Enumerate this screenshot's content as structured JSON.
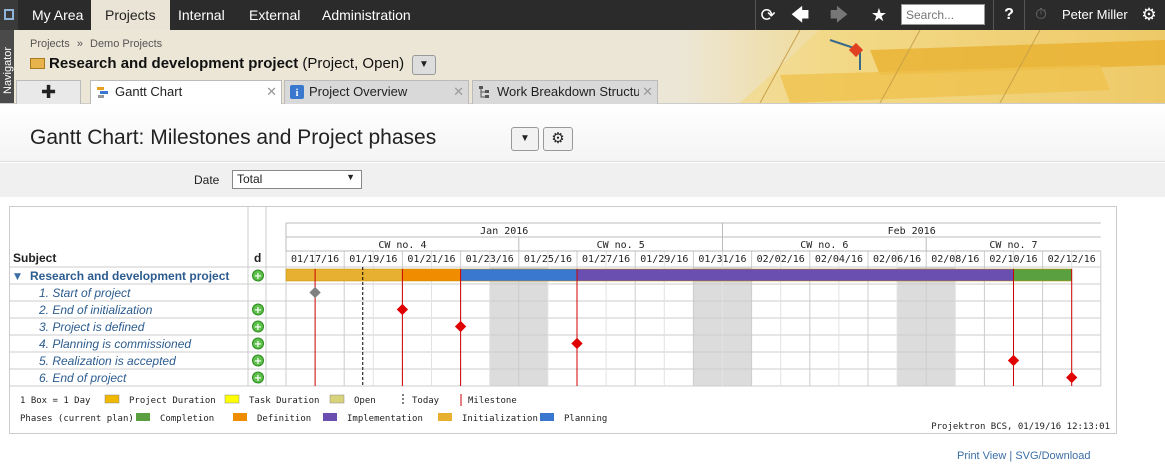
{
  "topnav": {
    "tabs": [
      "My Area",
      "Projects",
      "Internal",
      "External",
      "Administration"
    ],
    "active": "Projects",
    "search_placeholder": "Search...",
    "user": "Peter Miller"
  },
  "navigator_label": "Navigator",
  "breadcrumb": {
    "parent": "Projects",
    "separator": "»",
    "current": "Demo Projects"
  },
  "project": {
    "name": "Research and development project",
    "status": "(Project, Open)"
  },
  "tabs": [
    {
      "label": "Gantt Chart",
      "active": true
    },
    {
      "label": "Project Overview",
      "active": false
    },
    {
      "label": "Work Breakdown Structur",
      "active": false
    }
  ],
  "page_title": "Gantt Chart: Milestones and Project phases",
  "filter": {
    "label": "Date",
    "value": "Total"
  },
  "gantt": {
    "subject_header": "Subject",
    "d_header": "d",
    "months": [
      {
        "label": "Jan 2016",
        "start": 0,
        "end": 15
      },
      {
        "label": "Feb 2016",
        "start": 15,
        "end": 28
      }
    ],
    "weeks": [
      {
        "label": "CW no. 4",
        "start": 0,
        "end": 8
      },
      {
        "label": "CW no. 5",
        "start": 8,
        "end": 15
      },
      {
        "label": "CW no. 6",
        "start": 15,
        "end": 22
      },
      {
        "label": "CW no. 7",
        "start": 22,
        "end": 28
      }
    ],
    "date_labels": [
      "01/17/16",
      "01/19/16",
      "01/21/16",
      "01/23/16",
      "01/25/16",
      "01/27/16",
      "01/29/16",
      "01/31/16",
      "02/02/16",
      "02/04/16",
      "02/06/16",
      "02/08/16",
      "02/10/16",
      "02/12/16"
    ],
    "weekend_days": [
      7,
      8,
      14,
      15,
      21,
      22
    ],
    "today_day": 2,
    "rows": [
      {
        "label": "Research and development project",
        "type": "project"
      },
      {
        "label": "1. Start of project",
        "type": "milestone",
        "day": 1,
        "grey": true
      },
      {
        "label": "2. End of initialization",
        "type": "milestone",
        "day": 4
      },
      {
        "label": "3. Project is defined",
        "type": "milestone",
        "day": 6
      },
      {
        "label": "4. Planning is commissioned",
        "type": "milestone",
        "day": 10
      },
      {
        "label": "5. Realization is accepted",
        "type": "milestone",
        "day": 25
      },
      {
        "label": "6. End of project",
        "type": "milestone",
        "day": 27
      }
    ],
    "phases": [
      {
        "name": "Initialization",
        "start": 0,
        "end": 4,
        "color": "#e8b030"
      },
      {
        "name": "Definition",
        "start": 4,
        "end": 6,
        "color": "#f08c00"
      },
      {
        "name": "Planning",
        "start": 6,
        "end": 10,
        "color": "#3a78d0"
      },
      {
        "name": "Implementation",
        "start": 10,
        "end": 25,
        "color": "#6a4fb0"
      },
      {
        "name": "Completion",
        "start": 25,
        "end": 27,
        "color": "#5aa040"
      }
    ],
    "legend": {
      "box": "1 Box = 1 Day",
      "items": [
        {
          "label": "Project Duration",
          "color": "#f0b800"
        },
        {
          "label": "Task Duration",
          "color": "#ffff00"
        },
        {
          "label": "Open",
          "color": "#d8d27a"
        },
        {
          "label": "Today",
          "color": ""
        },
        {
          "label": "Milestone",
          "color": "#cc0000"
        }
      ],
      "phases_label": "Phases (current plan)",
      "phase_items": [
        {
          "label": "Completion",
          "color": "#5aa040"
        },
        {
          "label": "Definition",
          "color": "#f08c00"
        },
        {
          "label": "Implementation",
          "color": "#6a4fb0"
        },
        {
          "label": "Initialization",
          "color": "#e8b030"
        },
        {
          "label": "Planning",
          "color": "#3a78d0"
        }
      ]
    },
    "stamp": "Projektron BCS, 01/19/16 12:13:01"
  },
  "footer": {
    "print": "Print View",
    "sep": "|",
    "svg": "SVG/Download"
  }
}
